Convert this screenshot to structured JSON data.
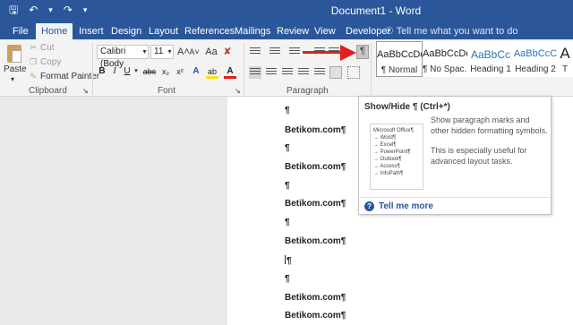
{
  "title_bar": {
    "save_icon": "save-icon",
    "undo_icon": "undo-icon",
    "redo_icon": "redo-icon",
    "customize_icon": "chevron-down-icon",
    "document_title": "Document1 - Word"
  },
  "tabs": [
    {
      "label": "File"
    },
    {
      "label": "Home"
    },
    {
      "label": "Insert"
    },
    {
      "label": "Design"
    },
    {
      "label": "Layout"
    },
    {
      "label": "References"
    },
    {
      "label": "Mailings"
    },
    {
      "label": "Review"
    },
    {
      "label": "View"
    },
    {
      "label": "Developer"
    }
  ],
  "tell_me": {
    "icon": "lightbulb-icon",
    "placeholder": "Tell me what you want to do"
  },
  "clipboard": {
    "paste_label": "Paste",
    "cut_label": "Cut",
    "copy_label": "Copy",
    "format_painter_label": "Format Painter",
    "group_label": "Clipboard"
  },
  "font": {
    "font_name": "Calibri (Body",
    "font_size": "11",
    "bold": "B",
    "italic": "I",
    "underline": "U",
    "strikethrough": "abc",
    "subscript": "x₂",
    "superscript": "x²",
    "grow": "A˄",
    "shrink": "A˅",
    "change_case": "Aa",
    "group_label": "Font"
  },
  "paragraph": {
    "group_label": "Paragraph",
    "show_hide_glyph": "¶"
  },
  "styles": [
    {
      "sample": "AaBbCcDd",
      "name": "¶ Normal",
      "selected": true
    },
    {
      "sample": "AaBbCcDd",
      "name": "¶ No Spac...",
      "selected": false
    },
    {
      "sample": "AaBbCc",
      "name": "Heading 1",
      "selected": false
    },
    {
      "sample": "AaBbCcC",
      "name": "Heading 2",
      "selected": false
    },
    {
      "sample": "A",
      "name": "T",
      "selected": false
    }
  ],
  "document": {
    "lines": [
      "¶",
      "Betikom.com¶",
      "¶",
      "Betikom.com¶",
      "¶",
      "Betikom.com¶",
      "¶",
      "Betikom.com¶",
      "¶",
      "¶",
      "Betikom.com¶",
      "Betikom.com¶"
    ]
  },
  "tooltip": {
    "title": "Show/Hide ¶ (Ctrl+*)",
    "description_1": "Show paragraph marks and other hidden formatting symbols.",
    "description_2": "This is especially useful for advanced layout tasks.",
    "thumbnail_lines": [
      "Microsoft Office¶",
      "→ Word¶",
      "→ Excel¶",
      "→ PowerPoint¶",
      "→ Outlook¶",
      "→ Access¶",
      "→ InfoPath¶"
    ],
    "help_label": "Tell me more"
  },
  "colors": {
    "brand": "#2b579a",
    "arrow": "#e01f1f",
    "highlight": "#f5e31a",
    "font_color": "#e01f1f"
  }
}
